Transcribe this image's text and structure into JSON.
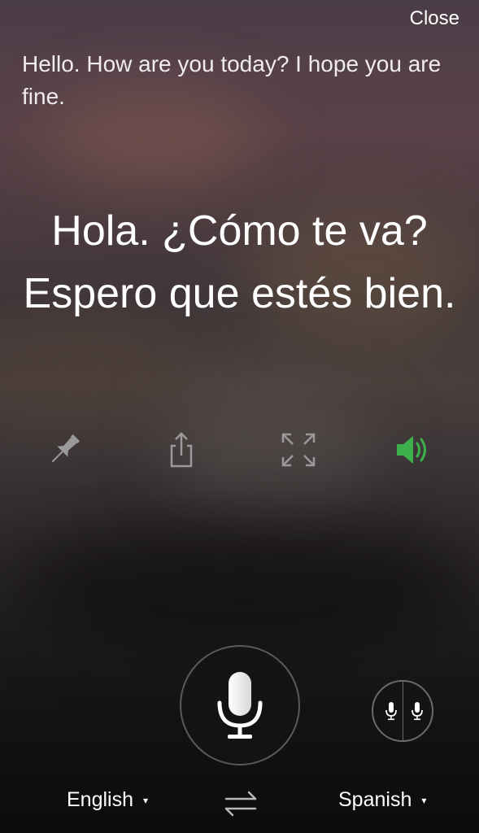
{
  "header": {
    "close_label": "Close"
  },
  "source": {
    "text": "Hello. How are you today? I hope you are fine."
  },
  "translation": {
    "text": "Hola. ¿Cómo te va? Espero que estés bien."
  },
  "actions": {
    "pin_icon": "pin-icon",
    "share_icon": "share-icon",
    "expand_icon": "expand-icon",
    "speaker_icon": "speaker-icon"
  },
  "colors": {
    "speaker_active": "#3cb04a",
    "icon_gray": "#9a9a9a"
  },
  "languages": {
    "source": "English",
    "target": "Spanish",
    "caret": "▾"
  }
}
